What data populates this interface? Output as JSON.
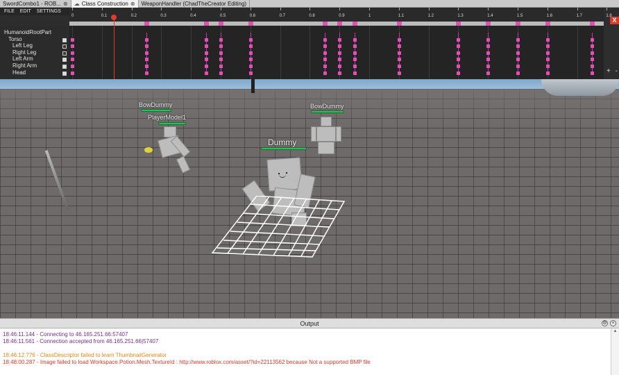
{
  "tabs": [
    {
      "label": "SwordCombo1 - ROB...",
      "active": false,
      "icon": "none"
    },
    {
      "label": "Class Construction",
      "active": true,
      "icon": "cloud-icon"
    },
    {
      "label": "WeaponHandler (ChadTheCreator Editing)",
      "active": false,
      "icon": "none"
    }
  ],
  "editor": {
    "menu": [
      "FILE",
      "EDIT",
      "SETTINGS"
    ],
    "ruler_labels": [
      "0",
      "0.1",
      "0.2",
      "0.3",
      "0.4",
      "0.5",
      "0.6",
      "0.7",
      "0.8",
      "0.9",
      "1",
      "1.1",
      "1.2",
      "1.3",
      "1.4",
      "1.5",
      "1.6",
      "1.7",
      "1.8"
    ],
    "playhead_time": 0.14,
    "keyframe_times": [
      0.25,
      0.45,
      0.5,
      0.6,
      0.85,
      0.9,
      0.95,
      1.1,
      1.3,
      1.4,
      1.5,
      1.6,
      1.75
    ],
    "tree": [
      {
        "label": "HumanoidRootPart",
        "indent": 0,
        "box": "none"
      },
      {
        "label": "Torso",
        "indent": 1,
        "box": "light"
      },
      {
        "label": "Left Leg",
        "indent": 2,
        "box": "dark"
      },
      {
        "label": "Right Leg",
        "indent": 2,
        "box": "dark"
      },
      {
        "label": "Left Arm",
        "indent": 2,
        "box": "light"
      },
      {
        "label": "Right Arm",
        "indent": 2,
        "box": "light"
      },
      {
        "label": "Head",
        "indent": 2,
        "box": "light"
      }
    ],
    "close_label": "X",
    "zoom_label": "+ -"
  },
  "viewport": {
    "labels": {
      "bowdummy_left": "BowDummy",
      "player_model": "PlayerModel1",
      "bowdummy_right": "BowDummy",
      "dummy": "Dummy"
    }
  },
  "output": {
    "title": "Output",
    "lines": [
      {
        "text": "18:46:11.144 - Connecting to 46.165.251.66:57407",
        "color": "#7a2b8a"
      },
      {
        "text": "18:46:11.561 - Connection accepted from 46.165.251.66|57407",
        "color": "#7a2b8a"
      },
      {
        "text": "",
        "color": "#000000"
      },
      {
        "text": "18:46:12.776 - ClassDescriptor failed to learn ThumbnailGenerator",
        "color": "#e0891b"
      },
      {
        "text": "18:48:00.287 - Image failed to load Workspace.Potion.Mesh.TextureId : http://www.roblox.com/asset/?id=22113562 because Not a supported BMP file",
        "color": "#d63a2a"
      }
    ]
  }
}
